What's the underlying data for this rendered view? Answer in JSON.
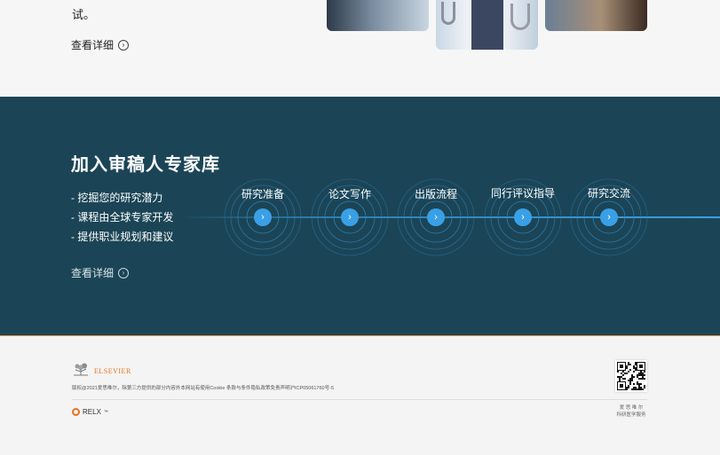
{
  "top": {
    "tail_text": "试。",
    "more_label": "查看详细",
    "more_icon": "circle-chevron-right-icon"
  },
  "band": {
    "title": "加入审稿人专家库",
    "bullets": [
      "- 挖掘您的研究潜力",
      "- 课程由全球专家开发",
      "- 提供职业规划和建议"
    ],
    "more_label": "查看详细",
    "steps": [
      {
        "label": "研究准备",
        "icon": "chevron-right-icon"
      },
      {
        "label": "论文写作",
        "icon": "chevron-right-icon"
      },
      {
        "label": "出版流程",
        "icon": "chevron-right-icon"
      },
      {
        "label": "同行评议指导",
        "icon": "chevron-right-icon"
      },
      {
        "label": "研究交流",
        "icon": "chevron-right-icon"
      }
    ],
    "colors": {
      "background": "#1b4556",
      "accent": "#3aa0e6",
      "ring": "#2f86c4"
    }
  },
  "footer": {
    "brand": "ELSEVIER",
    "copyright": "版权@2021爱思唯尔，除第三方提供的部分内容外本网站有使用Cookie  条款与条件隐私政策免责声明沪ICP05061760号-5",
    "relx": "RELX",
    "relx_tm": "™",
    "qr_caption_line1": "爱 思 唯 尔",
    "qr_caption_line2": "科研医学服务",
    "colors": {
      "orange": "#e9711c",
      "divider": "#f08a2b"
    }
  }
}
